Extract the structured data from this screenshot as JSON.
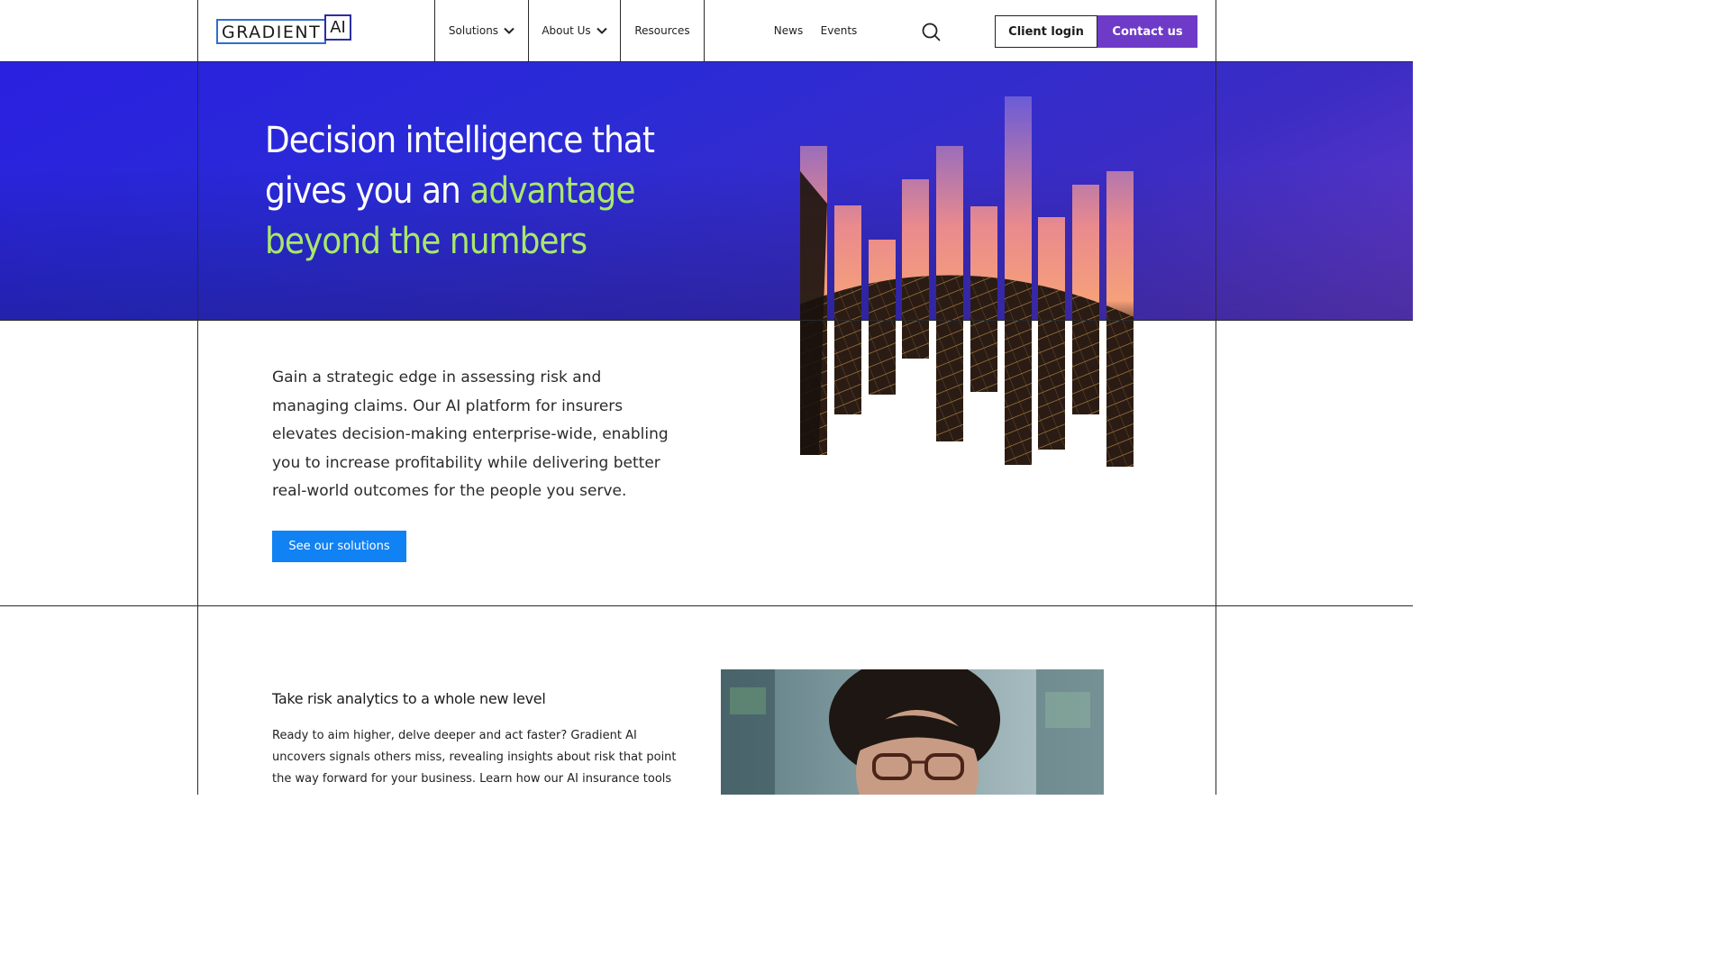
{
  "header": {
    "logo_word": "GRADIENT",
    "logo_ai": "AI",
    "nav": {
      "solutions": "Solutions",
      "about": "About Us",
      "resources": "Resources",
      "news": "News",
      "events": "Events"
    },
    "client_login": "Client login",
    "contact": "Contact us"
  },
  "hero": {
    "headline_part1": "Decision intelligence that gives you an ",
    "headline_highlight": "advantage beyond the numbers",
    "intro": "Gain a strategic edge in assessing risk and managing claims. Our AI platform for insurers elevates decision-making enterprise-wide, enabling you to increase profitability while delivering better real-world outcomes for the people you serve.",
    "cta": "See our solutions"
  },
  "section2": {
    "title": "Take risk analytics to a whole new level",
    "text": "Ready to aim higher, delve deeper and act faster? Gradient AI uncovers signals others miss, revealing insights about risk that point the way forward for your business. Learn how our AI insurance tools"
  },
  "colors": {
    "accent_green": "#a8e86a",
    "contact_purple": "#6e3bc8",
    "cta_blue": "#1182f3",
    "hero_blue": "#2a20e0"
  }
}
